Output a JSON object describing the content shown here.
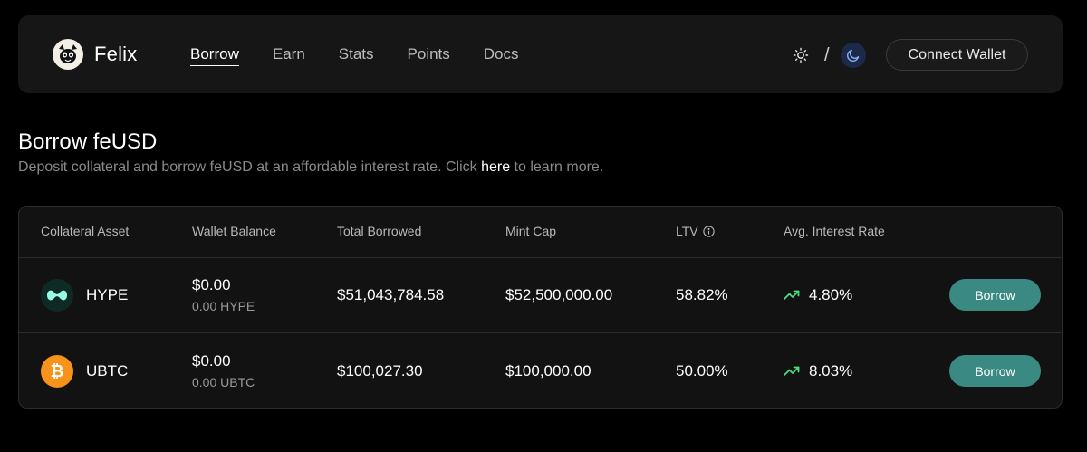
{
  "nav": {
    "brand": "Felix",
    "links": [
      {
        "label": "Borrow",
        "active": true
      },
      {
        "label": "Earn",
        "active": false
      },
      {
        "label": "Stats",
        "active": false
      },
      {
        "label": "Points",
        "active": false
      },
      {
        "label": "Docs",
        "active": false
      }
    ],
    "theme_separator": "/",
    "connect_label": "Connect Wallet"
  },
  "header": {
    "title": "Borrow feUSD",
    "subtitle_prefix": "Deposit collateral and borrow feUSD at an affordable interest rate. Click ",
    "subtitle_link": "here",
    "subtitle_suffix": " to learn more."
  },
  "table": {
    "columns": [
      "Collateral Asset",
      "Wallet Balance",
      "Total Borrowed",
      "Mint Cap",
      "LTV",
      "Avg. Interest Rate"
    ],
    "rows": [
      {
        "asset": "HYPE",
        "icon": "hype-icon",
        "wallet_usd": "$0.00",
        "wallet_token": "0.00 HYPE",
        "total_borrowed": "$51,043,784.58",
        "mint_cap": "$52,500,000.00",
        "ltv": "58.82%",
        "interest_rate": "4.80%",
        "action": "Borrow"
      },
      {
        "asset": "UBTC",
        "icon": "bitcoin-icon",
        "wallet_usd": "$0.00",
        "wallet_token": "0.00 UBTC",
        "total_borrowed": "$100,027.30",
        "mint_cap": "$100,000.00",
        "ltv": "50.00%",
        "interest_rate": "8.03%",
        "action": "Borrow"
      }
    ]
  },
  "colors": {
    "accent": "#3a8a83",
    "trend_up": "#4ade80",
    "bitcoin": "#f7931a",
    "hype": "#97fce4"
  }
}
